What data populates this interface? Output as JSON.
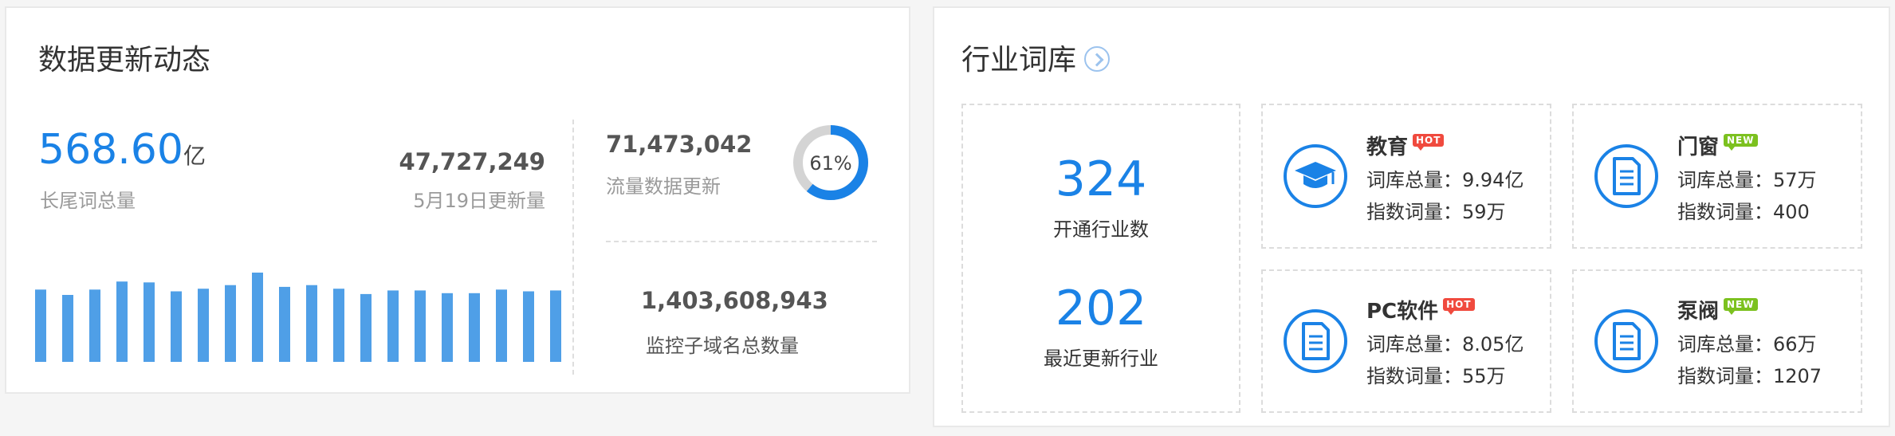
{
  "left_panel": {
    "title": "数据更新动态",
    "total_longtail": {
      "value": "568.60",
      "unit": "亿",
      "label": "长尾词总量"
    },
    "daily_update": {
      "value": "47,727,249",
      "label": "5月19日更新量"
    },
    "traffic_update": {
      "value": "71,473,042",
      "label": "流量数据更新",
      "percent_text": "61%",
      "percent": 0.61
    },
    "subdomain_total": {
      "value": "1,403,608,943",
      "label": "监控子域名总数量"
    },
    "trend_bars": [
      0.81,
      0.75,
      0.81,
      0.9,
      0.89,
      0.79,
      0.82,
      0.86,
      1.0,
      0.84,
      0.86,
      0.82,
      0.76,
      0.8,
      0.8,
      0.77,
      0.77,
      0.81,
      0.79,
      0.8
    ],
    "colors": {
      "accent": "#1a82e6",
      "bar": "#4f9fe7",
      "donut_track": "#d4d4d4"
    }
  },
  "right_panel": {
    "title": "行业词库",
    "stats": [
      {
        "value": "324",
        "label": "开通行业数"
      },
      {
        "value": "202",
        "label": "最近更新行业"
      }
    ],
    "industries": [
      {
        "name": "教育",
        "badge": "HOT",
        "icon": "graduation-cap-icon",
        "vocab_label": "词库总量：",
        "vocab_value": "9.94亿",
        "index_label": "指数词量：",
        "index_value": "59万"
      },
      {
        "name": "门窗",
        "badge": "NEW",
        "icon": "document-icon",
        "vocab_label": "词库总量：",
        "vocab_value": "57万",
        "index_label": "指数词量：",
        "index_value": "400"
      },
      {
        "name": "PC软件",
        "badge": "HOT",
        "icon": "document-icon",
        "vocab_label": "词库总量：",
        "vocab_value": "8.05亿",
        "index_label": "指数词量：",
        "index_value": "55万"
      },
      {
        "name": "泵阀",
        "badge": "NEW",
        "icon": "document-icon",
        "vocab_label": "词库总量：",
        "vocab_value": "66万",
        "index_label": "指数词量：",
        "index_value": "1207"
      }
    ]
  }
}
